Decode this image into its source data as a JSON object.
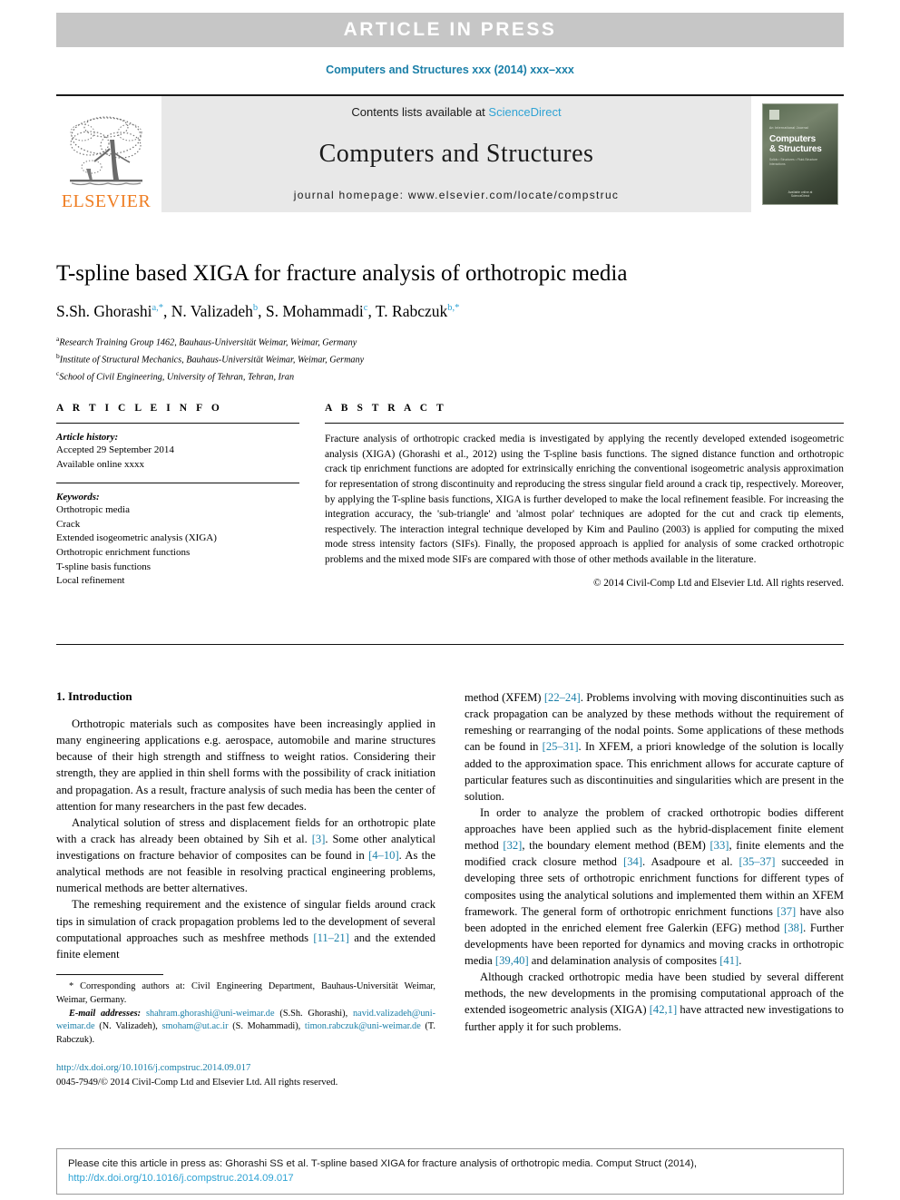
{
  "banner": {
    "text": "ARTICLE  IN  PRESS"
  },
  "running_head": "Computers and Structures xxx (2014) xxx–xxx",
  "masthead": {
    "contents_prefix": "Contents lists available at ",
    "sciencedirect": "ScienceDirect",
    "journal_name": "Computers and Structures",
    "homepage": "journal homepage: www.elsevier.com/locate/compstruc",
    "publisher_wordmark": "ELSEVIER",
    "cover": {
      "kicker": "An International Journal",
      "title_line1": "Computers",
      "title_line2": "& Structures",
      "subtitle": "Solids • Structures • Fluid-Structure Interactions",
      "footer_line1": "Available online at",
      "footer_line2": "ScienceDirect"
    }
  },
  "article": {
    "title": "T-spline based XIGA for fracture analysis of orthotropic media",
    "authors": [
      {
        "name": "S.Sh. Ghorashi",
        "marks": "a,*"
      },
      {
        "name": "N. Valizadeh",
        "marks": "b"
      },
      {
        "name": "S. Mohammadi",
        "marks": "c"
      },
      {
        "name": "T. Rabczuk",
        "marks": "b,*"
      }
    ],
    "affiliations": [
      {
        "mark": "a",
        "text": "Research Training Group 1462, Bauhaus-Universität Weimar, Weimar, Germany"
      },
      {
        "mark": "b",
        "text": "Institute of Structural Mechanics, Bauhaus-Universität Weimar, Weimar, Germany"
      },
      {
        "mark": "c",
        "text": "School of Civil Engineering, University of Tehran, Tehran, Iran"
      }
    ]
  },
  "article_info": {
    "heading": "A R T I C L E    I N F O",
    "history_label": "Article history:",
    "history_lines": [
      "Accepted 29 September 2014",
      "Available online xxxx"
    ],
    "keywords_label": "Keywords:",
    "keywords": [
      "Orthotropic media",
      "Crack",
      "Extended isogeometric analysis (XIGA)",
      "Orthotropic enrichment functions",
      "T-spline basis functions",
      "Local refinement"
    ]
  },
  "abstract": {
    "heading": "A B S T R A C T",
    "text": "Fracture analysis of orthotropic cracked media is investigated by applying the recently developed extended isogeometric analysis (XIGA) (Ghorashi et al., 2012) using the T-spline basis functions. The signed distance function and orthotropic crack tip enrichment functions are adopted for extrinsically enriching the conventional isogeometric analysis approximation for representation of strong discontinuity and reproducing the stress singular field around a crack tip, respectively. Moreover, by applying the T-spline basis functions, XIGA is further developed to make the local refinement feasible. For increasing the integration accuracy, the 'sub-triangle' and 'almost polar' techniques are adopted for the cut and crack tip elements, respectively. The interaction integral technique developed by Kim and Paulino (2003) is applied for computing the mixed mode stress intensity factors (SIFs). Finally, the proposed approach is applied for analysis of some cracked orthotropic problems and the mixed mode SIFs are compared with those of other methods available in the literature.",
    "copyright": "© 2014 Civil-Comp Ltd and Elsevier Ltd. All rights reserved."
  },
  "introduction": {
    "section_title": "1. Introduction",
    "left_paragraphs": [
      "Orthotropic materials such as composites have been increasingly applied in many engineering applications e.g. aerospace, automobile and marine structures because of their high strength and stiffness to weight ratios. Considering their strength, they are applied in thin shell forms with the possibility of crack initiation and propagation. As a result, fracture analysis of such media has been the center of attention for many researchers in the past few decades."
    ],
    "p2_a": "Analytical solution of stress and displacement fields for an orthotropic plate with a crack has already been obtained by Sih et al. ",
    "p2_r1": "[3]",
    "p2_b": ". Some other analytical investigations on fracture behavior of composites can be found in ",
    "p2_r2": "[4–10]",
    "p2_c": ". As the analytical methods are not feasible in resolving practical engineering problems, numerical methods are better alternatives.",
    "p3_a": "The remeshing requirement and the existence of singular fields around crack tips in simulation of crack propagation problems led to the development of several computational approaches such as meshfree methods ",
    "p3_r1": "[11–21]",
    "p3_b": " and the extended finite element",
    "right_p1_a": "method (XFEM) ",
    "right_p1_r1": "[22–24]",
    "right_p1_b": ". Problems involving with moving discontinuities such as crack propagation can be analyzed by these methods without the requirement of remeshing or rearranging of the nodal points. Some applications of these methods can be found in ",
    "right_p1_r2": "[25–31]",
    "right_p1_c": ". In XFEM, a priori knowledge of the solution is locally added to the approximation space. This enrichment allows for accurate capture of particular features such as discontinuities and singularities which are present in the solution.",
    "right_p2_a": "In order to analyze the problem of cracked orthotropic bodies different approaches have been applied such as the hybrid-displacement finite element method ",
    "right_p2_r1": "[32]",
    "right_p2_b": ", the boundary element method (BEM) ",
    "right_p2_r2": "[33]",
    "right_p2_c": ", finite elements and the modified crack closure method ",
    "right_p2_r3": "[34]",
    "right_p2_d": ". Asadpoure et al. ",
    "right_p2_r4": "[35–37]",
    "right_p2_e": " succeeded in developing three sets of orthotropic enrichment functions for different types of composites using the analytical solutions and implemented them within an XFEM framework. The general form of orthotropic enrichment functions ",
    "right_p2_r5": "[37]",
    "right_p2_f": " have also been adopted in the enriched element free Galerkin (EFG) method ",
    "right_p2_r6": "[38]",
    "right_p2_g": ". Further developments have been reported for dynamics and moving cracks in orthotropic media ",
    "right_p2_r7": "[39,40]",
    "right_p2_h": " and delamination analysis of composites ",
    "right_p2_r8": "[41]",
    "right_p2_i": ".",
    "right_p3_a": "Although cracked orthotropic media have been studied by several different methods, the new developments in the promising computational approach of the extended isogeometric analysis (XIGA) ",
    "right_p3_r1": "[42,1]",
    "right_p3_b": " have attracted new investigations to further apply it for such problems."
  },
  "footnote": {
    "corresponding_mark": "*",
    "corresponding_text": " Corresponding authors at: Civil Engineering Department, Bauhaus-Universität Weimar, Weimar, Germany.",
    "email_label": "E-mail addresses:",
    "emails": [
      {
        "address": "shahram.ghorashi@uni-weimar.de",
        "owner": " (S.Sh. Ghorashi), "
      },
      {
        "address": "navid.valizadeh@uni-weimar.de",
        "owner": " (N. Valizadeh), "
      },
      {
        "address": "smoham@ut.ac.ir",
        "owner": " (S. Mohammadi), "
      },
      {
        "address": "timon.rabczuk@uni-weimar.de",
        "owner": " (T. Rabczuk)."
      }
    ],
    "doi": "http://dx.doi.org/10.1016/j.compstruc.2014.09.017",
    "issn_line": "0045-7949/© 2014 Civil-Comp Ltd and Elsevier Ltd. All rights reserved."
  },
  "cite_box": {
    "text": "Please cite this article in press as: Ghorashi SS et al. T-spline based XIGA for fracture analysis of orthotropic media. Comput Struct (2014), ",
    "link": "http://dx.doi.org/10.1016/j.compstruc.2014.09.017"
  },
  "colors": {
    "banner_bg": "#c6c6c6",
    "link_blue": "#1a7fa8",
    "accent_blue": "#2fa3d4",
    "elsevier_orange": "#ef7d22"
  }
}
